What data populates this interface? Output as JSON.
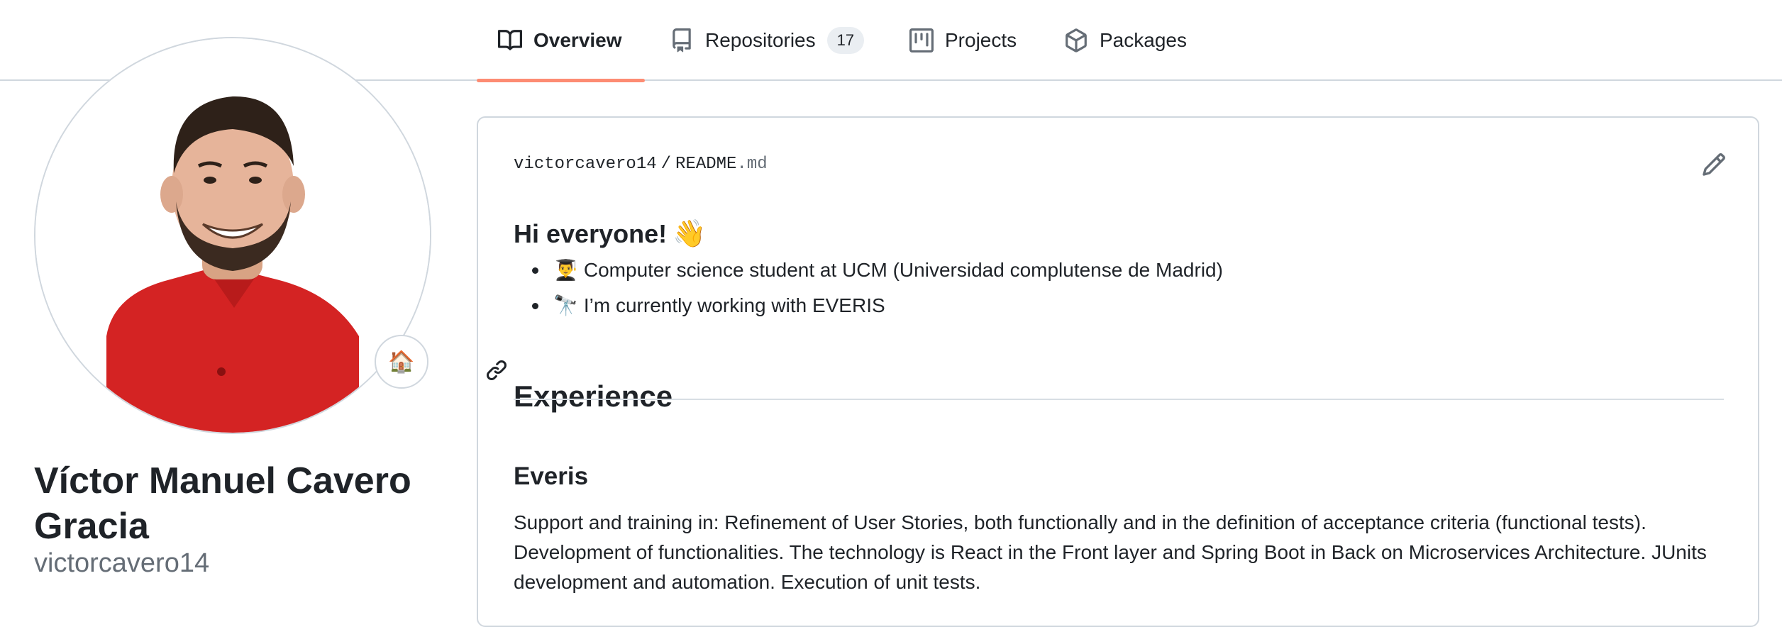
{
  "tabs": [
    {
      "label": "Overview",
      "icon": "book-icon",
      "active": true
    },
    {
      "label": "Repositories",
      "icon": "repo-icon",
      "count": "17"
    },
    {
      "label": "Projects",
      "icon": "project-icon"
    },
    {
      "label": "Packages",
      "icon": "package-icon"
    }
  ],
  "profile": {
    "full_name": "Víctor Manuel Cavero Gracia",
    "username": "victorcavero14",
    "status_emoji": "🏠"
  },
  "readme": {
    "owner": "victorcavero14",
    "separator": "/",
    "filename": "README",
    "extension": ".md",
    "greeting": "Hi everyone!",
    "greeting_emoji": "👋",
    "bullets": [
      {
        "emoji": "👨‍🎓",
        "text": "Computer science student at UCM (Universidad complutense de Madrid)"
      },
      {
        "emoji": "🔭",
        "text": "I’m currently working with EVERIS"
      }
    ],
    "experience_heading": "Experience",
    "company_heading": "Everis",
    "description": "Support and training in: Refinement of User Stories, both functionally and in the definition of acceptance criteria (functional tests). Development of functionalities. The technology is React in the Front layer and Spring Boot in Back on Microservices Architecture. JUnits development and automation. Execution of unit tests."
  },
  "colors": {
    "accent_underline": "#fd8c73",
    "border": "#d0d7de",
    "text": "#1f2328",
    "muted": "#656d76",
    "shirt": "#d42323"
  }
}
